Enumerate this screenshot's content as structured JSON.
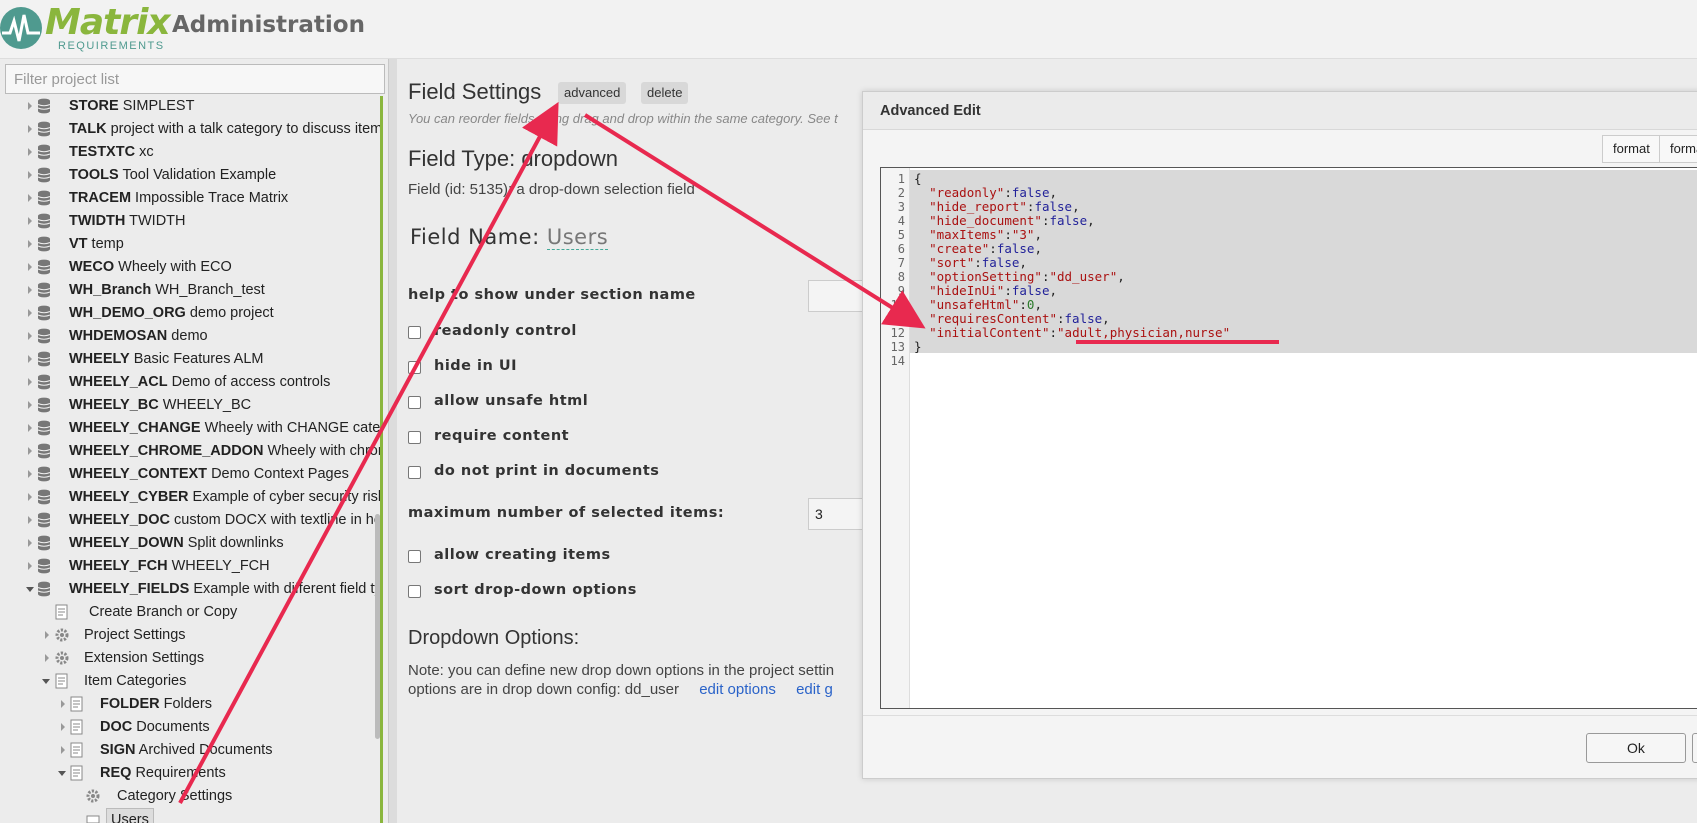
{
  "header": {
    "logo_name": "Matrix",
    "logo_sub": "REQUIREMENTS",
    "title": "Administration"
  },
  "sidebar": {
    "filter_placeholder": "Filter project list",
    "projects": [
      {
        "code": "STORE",
        "name": "SIMPLEST"
      },
      {
        "code": "TALK",
        "name": "project with a talk category to discuss items"
      },
      {
        "code": "TESTXTC",
        "name": "xc"
      },
      {
        "code": "TOOLS",
        "name": "Tool Validation Example"
      },
      {
        "code": "TRACEM",
        "name": "Impossible Trace Matrix"
      },
      {
        "code": "TWIDTH",
        "name": "TWIDTH"
      },
      {
        "code": "VT",
        "name": "temp"
      },
      {
        "code": "WECO",
        "name": "Wheely with ECO"
      },
      {
        "code": "WH_Branch",
        "name": "WH_Branch_test"
      },
      {
        "code": "WH_DEMO_ORG",
        "name": "demo project"
      },
      {
        "code": "WHDEMOSAN",
        "name": "demo"
      },
      {
        "code": "WHEELY",
        "name": "Basic Features ALM"
      },
      {
        "code": "WHEELY_ACL",
        "name": "Demo of access controls"
      },
      {
        "code": "WHEELY_BC",
        "name": "WHEELY_BC"
      },
      {
        "code": "WHEELY_CHANGE",
        "name": "Wheely with CHANGE categ"
      },
      {
        "code": "WHEELY_CHROME_ADDON",
        "name": "Wheely with chrom"
      },
      {
        "code": "WHEELY_CONTEXT",
        "name": "Demo Context Pages"
      },
      {
        "code": "WHEELY_CYBER",
        "name": "Example of cyber security risk"
      },
      {
        "code": "WHEELY_DOC",
        "name": "custom DOCX with textline in hea"
      },
      {
        "code": "WHEELY_DOWN",
        "name": "Split downlinks"
      },
      {
        "code": "WHEELY_FCH",
        "name": "WHEELY_FCH"
      },
      {
        "code": "WHEELY_FIELDS",
        "name": "Example with different field typ"
      }
    ],
    "sub_items": {
      "create_branch": "Create Branch or Copy",
      "project_settings": "Project Settings",
      "extension_settings": "Extension Settings",
      "item_categories": "Item Categories"
    },
    "categories": [
      {
        "code": "FOLDER",
        "name": "Folders"
      },
      {
        "code": "DOC",
        "name": "Documents"
      },
      {
        "code": "SIGN",
        "name": "Archived Documents"
      },
      {
        "code": "REQ",
        "name": "Requirements"
      }
    ],
    "req_children": {
      "category_settings": "Category Settings",
      "users": "Users"
    }
  },
  "main": {
    "field_settings_title": "Field Settings",
    "advanced_label": "advanced",
    "delete_label": "delete",
    "reorder_hint": "You can reorder fields using drag and drop within the same category. See t",
    "field_type": "Field Type: dropdown",
    "field_id": "Field (id: 5135): a drop-down selection field",
    "field_name_label": "Field Name:",
    "field_name_value": "Users",
    "help_label": "help to show under section name",
    "checks": {
      "readonly": "readonly control",
      "hide_ui": "hide in UI",
      "unsafe_html": "allow unsafe html",
      "require_content": "require content",
      "no_print": "do not print in documents",
      "allow_creating": "allow creating items",
      "sort_options": "sort drop-down options"
    },
    "max_items_label": "maximum number of selected items:",
    "max_items_value": "3",
    "dropdown_options_title": "Dropdown Options:",
    "note_line1": "Note: you can define new drop down options in the project settin",
    "note_line2_prefix": "options are in drop down config: dd_user",
    "edit_options": "edit options",
    "edit_g": "edit g"
  },
  "dialog": {
    "title": "Advanced Edit",
    "format_label": "format",
    "format2_label": "forma",
    "ok_label": "Ok",
    "line_numbers": [
      "1",
      "2",
      "3",
      "4",
      "5",
      "6",
      "7",
      "8",
      "9",
      "10",
      "11",
      "12",
      "13",
      "14"
    ],
    "json_open": "{",
    "json_close": "}",
    "entries": [
      {
        "key": "\"readonly\"",
        "val": "false",
        "type": "b",
        "comma": ","
      },
      {
        "key": "\"hide_report\"",
        "val": "false",
        "type": "b",
        "comma": ","
      },
      {
        "key": "\"hide_document\"",
        "val": "false",
        "type": "b",
        "comma": ","
      },
      {
        "key": "\"maxItems\"",
        "val": "\"3\"",
        "type": "s",
        "comma": ","
      },
      {
        "key": "\"create\"",
        "val": "false",
        "type": "b",
        "comma": ","
      },
      {
        "key": "\"sort\"",
        "val": "false",
        "type": "b",
        "comma": ","
      },
      {
        "key": "\"optionSetting\"",
        "val": "\"dd_user\"",
        "type": "s",
        "comma": ","
      },
      {
        "key": "\"hideInUi\"",
        "val": "false",
        "type": "b",
        "comma": ","
      },
      {
        "key": "\"unsafeHtml\"",
        "val": "0",
        "type": "n",
        "comma": ","
      },
      {
        "key": "\"requiresContent\"",
        "val": "false",
        "type": "b",
        "comma": ","
      },
      {
        "key": "\"initialContent\"",
        "val": "\"adult,physician,nurse\"",
        "type": "s",
        "comma": ""
      }
    ]
  },
  "colors": {
    "brand_green": "#8ab63d",
    "brand_teal": "#4f9a8f",
    "annotation_red": "#e8294f"
  }
}
